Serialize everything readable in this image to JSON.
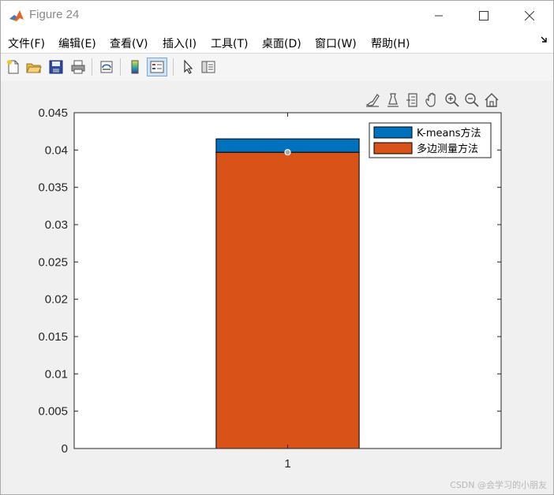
{
  "window": {
    "title": "Figure 24"
  },
  "menu": {
    "items": [
      "文件(F)",
      "编辑(E)",
      "查看(V)",
      "插入(I)",
      "工具(T)",
      "桌面(D)",
      "窗口(W)",
      "帮助(H)"
    ]
  },
  "toolbar": {
    "buttons": [
      "new-figure-icon",
      "open-file-icon",
      "save-icon",
      "print-icon",
      "link-plot-icon",
      "colorbar-icon",
      "legend-icon",
      "pointer-icon",
      "property-inspector-icon"
    ]
  },
  "axes_toolbar": {
    "buttons": [
      "brush-icon",
      "data-tips-icon",
      "datacursor-icon",
      "pan-icon",
      "zoom-in-icon",
      "zoom-out-icon",
      "home-icon"
    ]
  },
  "chart_data": {
    "type": "bar",
    "stacked": true,
    "categories": [
      "1"
    ],
    "series": [
      {
        "name": "多边测量方法",
        "values": [
          0.0397
        ],
        "color": "#d95319"
      },
      {
        "name": "K-means方法",
        "values": [
          0.0018
        ],
        "color": "#0072bd"
      }
    ],
    "ylim": [
      0,
      0.045
    ],
    "yticks": [
      "0",
      "0.005",
      "0.01",
      "0.015",
      "0.02",
      "0.025",
      "0.03",
      "0.035",
      "0.04",
      "0.045"
    ],
    "legend": {
      "placement": "top-right",
      "entries": [
        "K-means方法",
        "多边测量方法"
      ]
    },
    "marker_value": 0.0397,
    "grid": false
  },
  "watermark": "CSDN @会学习的小朋友"
}
